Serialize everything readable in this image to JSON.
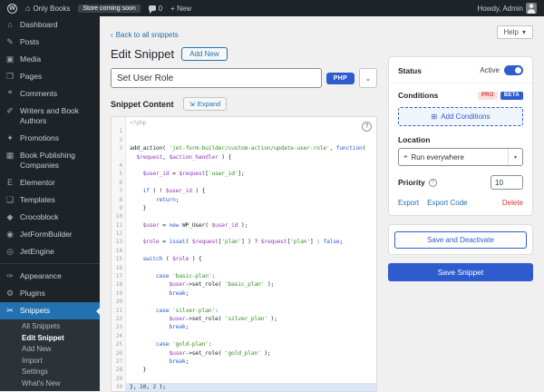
{
  "colors": {
    "accent": "#2271b1",
    "brand": "#2e5bce",
    "danger": "#d63638",
    "menu_bg": "#1d2327"
  },
  "admin_bar": {
    "site_name": "Only Books",
    "coming_soon": "Store coming soon",
    "comments_count": "0",
    "new_label": "+ New",
    "howdy": "Howdy, Admin"
  },
  "sidebar": {
    "items": [
      {
        "name": "dashboard",
        "glyph": "⌂",
        "label": "Dashboard"
      },
      {
        "name": "posts",
        "glyph": "✎",
        "label": "Posts"
      },
      {
        "name": "media",
        "glyph": "▣",
        "label": "Media"
      },
      {
        "name": "pages",
        "glyph": "❐",
        "label": "Pages"
      },
      {
        "name": "comments",
        "glyph": "❝",
        "label": "Comments"
      },
      {
        "name": "writers-and-book-authors",
        "glyph": "✐",
        "label": "Writers and Book Authors"
      },
      {
        "name": "promotions",
        "glyph": "✦",
        "label": "Promotions"
      },
      {
        "name": "book-publishing-companies",
        "glyph": "▦",
        "label": "Book Publishing Companies"
      },
      {
        "name": "elementor",
        "glyph": "E",
        "label": "Elementor"
      },
      {
        "name": "templates",
        "glyph": "❏",
        "label": "Templates"
      },
      {
        "name": "crocoblock",
        "glyph": "◆",
        "label": "Crocoblock"
      },
      {
        "name": "jetformbuilder",
        "glyph": "◉",
        "label": "JetFormBuilder"
      },
      {
        "name": "jetengine",
        "glyph": "◎",
        "label": "JetEngine"
      },
      {
        "name": "appearance",
        "glyph": "✑",
        "label": "Appearance",
        "separator_before": true
      },
      {
        "name": "plugins",
        "glyph": "⚙",
        "label": "Plugins"
      },
      {
        "name": "snippets",
        "glyph": "✂",
        "label": "Snippets",
        "current": true
      }
    ],
    "submenu": [
      {
        "label": "All Snippets"
      },
      {
        "label": "Edit Snippet",
        "current": true
      },
      {
        "label": "Add New"
      },
      {
        "label": "Import"
      },
      {
        "label": "Settings"
      },
      {
        "label": "What's New"
      }
    ]
  },
  "toolbar": {
    "back_label": "Back to all snippets",
    "help_label": "Help"
  },
  "page": {
    "title": "Edit Snippet",
    "add_new_label": "Add New"
  },
  "snippet": {
    "title_value": "Set User Role",
    "type_badge": "PHP",
    "content_label": "Snippet Content",
    "expand_label": "Expand",
    "phantom": "<?php"
  },
  "code": {
    "rows": [
      {
        "n": "",
        "t": [
          [
            "ph",
            "<?php"
          ]
        ]
      },
      {
        "n": "1",
        "t": []
      },
      {
        "n": "2",
        "t": []
      },
      {
        "n": "3",
        "t": [
          [
            "p",
            "add_action( "
          ],
          [
            "s",
            "'jet-form-builder/custom-action/update-user-role'"
          ],
          [
            "p",
            ", "
          ],
          [
            "k",
            "function"
          ],
          [
            "p",
            "("
          ]
        ]
      },
      {
        "n": "",
        "t": [
          [
            "p",
            "  "
          ],
          [
            "v",
            "$request"
          ],
          [
            "p",
            ", "
          ],
          [
            "v",
            "$action_handler"
          ],
          [
            "p",
            " ) {"
          ]
        ]
      },
      {
        "n": "4",
        "t": []
      },
      {
        "n": "5",
        "t": [
          [
            "p",
            "    "
          ],
          [
            "v",
            "$user_id"
          ],
          [
            "p",
            " = "
          ],
          [
            "v",
            "$request"
          ],
          [
            "p",
            "["
          ],
          [
            "s",
            "'user_id'"
          ],
          [
            "p",
            "];"
          ]
        ]
      },
      {
        "n": "6",
        "t": []
      },
      {
        "n": "7",
        "t": [
          [
            "p",
            "    "
          ],
          [
            "k",
            "if"
          ],
          [
            "p",
            " ( ! "
          ],
          [
            "v",
            "$user_id"
          ],
          [
            "p",
            " ) {"
          ]
        ]
      },
      {
        "n": "8",
        "t": [
          [
            "p",
            "        "
          ],
          [
            "k",
            "return"
          ],
          [
            "p",
            ";"
          ]
        ]
      },
      {
        "n": "9",
        "t": [
          [
            "p",
            "    }"
          ]
        ]
      },
      {
        "n": "10",
        "t": []
      },
      {
        "n": "11",
        "t": [
          [
            "p",
            "    "
          ],
          [
            "v",
            "$user"
          ],
          [
            "p",
            " = "
          ],
          [
            "k",
            "new"
          ],
          [
            "p",
            " WP_User( "
          ],
          [
            "v",
            "$user_id"
          ],
          [
            "p",
            " );"
          ]
        ]
      },
      {
        "n": "12",
        "t": []
      },
      {
        "n": "13",
        "t": [
          [
            "p",
            "    "
          ],
          [
            "v",
            "$role"
          ],
          [
            "p",
            " = "
          ],
          [
            "k",
            "isset"
          ],
          [
            "p",
            "( "
          ],
          [
            "v",
            "$request"
          ],
          [
            "p",
            "["
          ],
          [
            "s",
            "'plan'"
          ],
          [
            "p",
            "] ) ? "
          ],
          [
            "v",
            "$request"
          ],
          [
            "p",
            "["
          ],
          [
            "s",
            "'plan'"
          ],
          [
            "p",
            "] : "
          ],
          [
            "k",
            "false"
          ],
          [
            "p",
            ";"
          ]
        ]
      },
      {
        "n": "14",
        "t": []
      },
      {
        "n": "15",
        "t": [
          [
            "p",
            "    "
          ],
          [
            "k",
            "switch"
          ],
          [
            "p",
            " ( "
          ],
          [
            "v",
            "$role"
          ],
          [
            "p",
            " ) {"
          ]
        ]
      },
      {
        "n": "16",
        "t": []
      },
      {
        "n": "17",
        "t": [
          [
            "p",
            "        "
          ],
          [
            "k",
            "case"
          ],
          [
            "p",
            " "
          ],
          [
            "s",
            "'basic-plan'"
          ],
          [
            "p",
            ":"
          ]
        ]
      },
      {
        "n": "18",
        "t": [
          [
            "p",
            "            "
          ],
          [
            "v",
            "$user"
          ],
          [
            "p",
            "->set_role( "
          ],
          [
            "s",
            "'basic_plan'"
          ],
          [
            "p",
            " );"
          ]
        ]
      },
      {
        "n": "19",
        "t": [
          [
            "p",
            "            "
          ],
          [
            "k",
            "break"
          ],
          [
            "p",
            ";"
          ]
        ]
      },
      {
        "n": "20",
        "t": []
      },
      {
        "n": "21",
        "t": [
          [
            "p",
            "        "
          ],
          [
            "k",
            "case"
          ],
          [
            "p",
            " "
          ],
          [
            "s",
            "'silver-plan'"
          ],
          [
            "p",
            ":"
          ]
        ]
      },
      {
        "n": "22",
        "t": [
          [
            "p",
            "            "
          ],
          [
            "v",
            "$user"
          ],
          [
            "p",
            "->set_role( "
          ],
          [
            "s",
            "'silver_plan'"
          ],
          [
            "p",
            " );"
          ]
        ]
      },
      {
        "n": "23",
        "t": [
          [
            "p",
            "            "
          ],
          [
            "k",
            "break"
          ],
          [
            "p",
            ";"
          ]
        ]
      },
      {
        "n": "24",
        "t": []
      },
      {
        "n": "25",
        "t": [
          [
            "p",
            "        "
          ],
          [
            "k",
            "case"
          ],
          [
            "p",
            " "
          ],
          [
            "s",
            "'gold-plan'"
          ],
          [
            "p",
            ":"
          ]
        ]
      },
      {
        "n": "26",
        "t": [
          [
            "p",
            "            "
          ],
          [
            "v",
            "$user"
          ],
          [
            "p",
            "->set_role( "
          ],
          [
            "s",
            "'gold_plan'"
          ],
          [
            "p",
            " );"
          ]
        ]
      },
      {
        "n": "27",
        "t": [
          [
            "p",
            "            "
          ],
          [
            "k",
            "break"
          ],
          [
            "p",
            ";"
          ]
        ]
      },
      {
        "n": "28",
        "t": [
          [
            "p",
            "    }"
          ]
        ]
      },
      {
        "n": "29",
        "t": []
      },
      {
        "n": "30",
        "a": true,
        "t": [
          [
            "p",
            "}, "
          ],
          [
            "n",
            "10"
          ],
          [
            "p",
            ", "
          ],
          [
            "n",
            "2"
          ],
          [
            "p",
            " );"
          ]
        ]
      }
    ]
  },
  "panel": {
    "status_label": "Status",
    "status_value": "Active",
    "conditions_label": "Conditions",
    "pro_badge": "PRO",
    "beta_badge": "BETA",
    "add_conditions_label": "Add Conditions",
    "location_label": "Location",
    "location_value": "Run everywhere",
    "priority_label": "Priority",
    "priority_value": "10",
    "export_label": "Export",
    "export_code_label": "Export Code",
    "delete_label": "Delete",
    "save_deactivate_label": "Save and Deactivate",
    "save_label": "Save Snippet"
  }
}
